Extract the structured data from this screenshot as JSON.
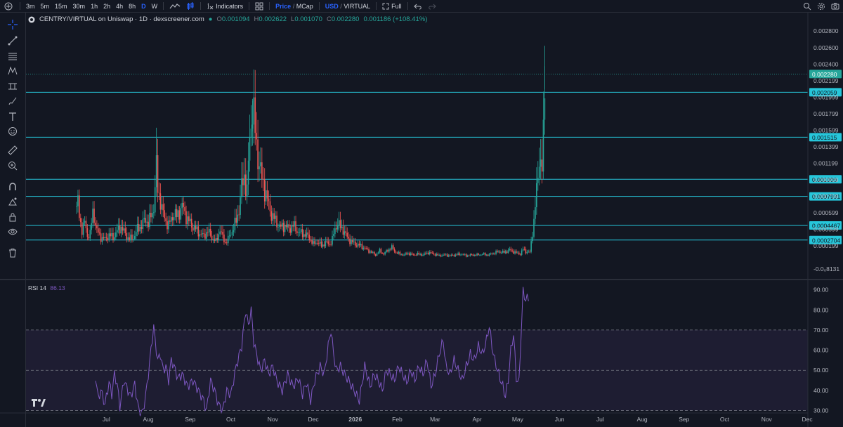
{
  "toolbar": {
    "timeframes": [
      "3m",
      "5m",
      "15m",
      "30m",
      "1h",
      "2h",
      "4h",
      "8h",
      "D",
      "W"
    ],
    "active_timeframe": "D",
    "indicators_label": "Indicators",
    "price_label": "Price",
    "mcap_label": "MCap",
    "price_mcap_sep": "/",
    "usd_label": "USD",
    "virtual_label": "VIRTUAL",
    "full_label": "Full"
  },
  "legend": {
    "title": "CENTRY/VIRTUAL on Uniswap · 1D · dexscreener.com",
    "open_label": "O",
    "open": "0.001094",
    "high_label": "H",
    "high": "0.002622",
    "low_label": "L",
    "low": "0.001070",
    "close_label": "C",
    "close": "0.002280",
    "change": "0.001186 (+108.41%)"
  },
  "rsi_legend": {
    "label": "RSI",
    "period": "14",
    "value": "86.13"
  },
  "colors": {
    "up": "#26a69a",
    "down": "#ef5350",
    "rsi_line": "#7e57c2",
    "rsi_band": "#7e57c2",
    "hline": "#26c6da",
    "background": "#131722",
    "accent": "#2962ff"
  },
  "chart_data": [
    {
      "type": "candlestick",
      "title": "CENTRY/VIRTUAL on Uniswap · 1D · dexscreener.com",
      "y_scale": "price",
      "ylim": [
        -8e-05,
        0.00287
      ],
      "y_ticks": [
        "0.002800",
        "0.002600",
        "0.002400",
        "0.002199",
        "0.001999",
        "0.001799",
        "0.001599",
        "0.001399",
        "0.001199",
        "0.000999",
        "0.000799",
        "0.000599",
        "0.000399",
        "0.000199"
      ],
      "y_tick_values": [
        0.0028,
        0.0026,
        0.0024,
        0.0022,
        0.002,
        0.0018,
        0.0016,
        0.0014,
        0.0012,
        0.001,
        0.0008,
        0.0006,
        0.0004,
        0.0002
      ],
      "bottom_tick": "-0.0⁠⁠​08131",
      "bottom_tick_value": -8.13e-05,
      "horizontal_lines": [
        0.002059,
        0.001515,
        0.001006,
        0.0007991,
        0.0004467,
        0.0002704
      ],
      "horizontal_line_labels": [
        "0.002059",
        "0.001515",
        "0.001006",
        "0.0007991",
        "0.0004467",
        "0.0002704"
      ],
      "last_price": 0.00228,
      "last_price_label": "0.002280",
      "x_tick_labels": [
        "Jul",
        "Aug",
        "Sep",
        "Oct",
        "Nov",
        "Dec",
        "2026",
        "Feb",
        "Mar",
        "Apr",
        "May",
        "Jun",
        "Jul",
        "Aug",
        "Sep",
        "Oct",
        "Nov",
        "Dec"
      ],
      "x_tick_days": [
        22,
        53,
        84,
        114,
        145,
        175,
        206,
        237,
        265,
        296,
        326,
        357,
        387,
        418,
        449,
        479,
        510,
        540
      ],
      "anchors_day_close": [
        [
          0,
          0.00068
        ],
        [
          1,
          0.00072
        ],
        [
          2,
          0.00055
        ],
        [
          4,
          0.0004
        ],
        [
          6,
          0.00048
        ],
        [
          8,
          0.00032
        ],
        [
          10,
          0.00035
        ],
        [
          12,
          0.0006
        ],
        [
          13,
          0.00055
        ],
        [
          15,
          0.00038
        ],
        [
          18,
          0.0003
        ],
        [
          21,
          0.00028
        ],
        [
          24,
          0.00033
        ],
        [
          27,
          0.0003
        ],
        [
          30,
          0.00038
        ],
        [
          33,
          0.00043
        ],
        [
          36,
          0.00034
        ],
        [
          39,
          0.00028
        ],
        [
          42,
          0.0003
        ],
        [
          45,
          0.0004
        ],
        [
          48,
          0.00045
        ],
        [
          51,
          0.00052
        ],
        [
          53,
          0.00048
        ],
        [
          55,
          0.00055
        ],
        [
          57,
          0.00066
        ],
        [
          58,
          0.00095
        ],
        [
          59,
          0.00112
        ],
        [
          60,
          0.00088
        ],
        [
          62,
          0.00075
        ],
        [
          64,
          0.00058
        ],
        [
          66,
          0.0005
        ],
        [
          68,
          0.00045
        ],
        [
          70,
          0.00052
        ],
        [
          72,
          0.0006
        ],
        [
          74,
          0.00055
        ],
        [
          76,
          0.00062
        ],
        [
          78,
          0.00068
        ],
        [
          80,
          0.0006
        ],
        [
          82,
          0.00052
        ],
        [
          85,
          0.00045
        ],
        [
          88,
          0.0004
        ],
        [
          91,
          0.00035
        ],
        [
          94,
          0.00032
        ],
        [
          97,
          0.00038
        ],
        [
          100,
          0.0003
        ],
        [
          103,
          0.00025
        ],
        [
          106,
          0.0004
        ],
        [
          108,
          0.0003
        ],
        [
          110,
          0.00024
        ],
        [
          112,
          0.00028
        ],
        [
          114,
          0.00035
        ],
        [
          116,
          0.00042
        ],
        [
          118,
          0.0005
        ],
        [
          120,
          0.00065
        ],
        [
          122,
          0.0009
        ],
        [
          124,
          0.00105
        ],
        [
          126,
          0.00085
        ],
        [
          128,
          0.0015
        ],
        [
          130,
          0.0019
        ],
        [
          131,
          0.00175
        ],
        [
          133,
          0.0014
        ],
        [
          135,
          0.0012
        ],
        [
          137,
          0.001
        ],
        [
          139,
          0.0009
        ],
        [
          141,
          0.00075
        ],
        [
          143,
          0.00063
        ],
        [
          145,
          0.00055
        ],
        [
          148,
          0.00048
        ],
        [
          151,
          0.00042
        ],
        [
          154,
          0.00045
        ],
        [
          157,
          0.0004
        ],
        [
          160,
          0.00045
        ],
        [
          163,
          0.00038
        ],
        [
          166,
          0.00035
        ],
        [
          169,
          0.00034
        ],
        [
          172,
          0.0003
        ],
        [
          175,
          0.00022
        ],
        [
          178,
          0.00025
        ],
        [
          181,
          0.0002
        ],
        [
          184,
          0.00024
        ],
        [
          187,
          0.00022
        ],
        [
          189,
          0.00028
        ],
        [
          191,
          0.0004
        ],
        [
          193,
          0.00048
        ],
        [
          195,
          0.00042
        ],
        [
          197,
          0.0004
        ],
        [
          200,
          0.0003
        ],
        [
          203,
          0.00025
        ],
        [
          206,
          0.00022
        ],
        [
          210,
          0.0002
        ],
        [
          214,
          0.00016
        ],
        [
          218,
          0.00012
        ],
        [
          221,
          9e-05
        ],
        [
          224,
          0.00014
        ],
        [
          227,
          0.0001
        ],
        [
          230,
          0.00015
        ],
        [
          233,
          0.00018
        ],
        [
          236,
          0.00012
        ],
        [
          239,
          0.0001
        ],
        [
          242,
          9e-05
        ],
        [
          245,
          0.00011
        ],
        [
          248,
          9e-05
        ],
        [
          252,
          0.0001
        ],
        [
          256,
          9e-05
        ],
        [
          260,
          0.00012
        ],
        [
          264,
          0.0001
        ],
        [
          268,
          8e-05
        ],
        [
          272,
          9e-05
        ],
        [
          276,
          8e-05
        ],
        [
          280,
          9e-05
        ],
        [
          284,
          0.0001
        ],
        [
          288,
          8e-05
        ],
        [
          292,
          9e-05
        ],
        [
          296,
          9e-05
        ],
        [
          300,
          0.0001
        ],
        [
          304,
          9e-05
        ],
        [
          308,
          0.00011
        ],
        [
          312,
          0.00013
        ],
        [
          316,
          0.00012
        ],
        [
          320,
          0.00015
        ],
        [
          324,
          0.00012
        ],
        [
          328,
          0.0001
        ],
        [
          330,
          0.00016
        ],
        [
          332,
          0.00013
        ],
        [
          335,
          0.00012
        ],
        [
          338,
          0.0005
        ],
        [
          340,
          0.00085
        ],
        [
          342,
          0.0013
        ],
        [
          344,
          0.0011
        ],
        [
          345,
          0.0015
        ],
        [
          346,
          0.00228
        ]
      ],
      "total_days": 346
    },
    {
      "type": "line",
      "title": "RSI 14",
      "ylim": [
        26,
        93
      ],
      "y_ticks": [
        "90.00",
        "80.00",
        "70.00",
        "60.00",
        "50.00",
        "40.00",
        "30.00"
      ],
      "y_tick_values": [
        90,
        80,
        70,
        60,
        50,
        40,
        30
      ],
      "bands": {
        "upper": 70,
        "middle": 50,
        "lower": 30
      },
      "last_value": 86.13,
      "anchors_day_value": [
        [
          14,
          47
        ],
        [
          16,
          36
        ],
        [
          18,
          40
        ],
        [
          21,
          33
        ],
        [
          24,
          44
        ],
        [
          26,
          38
        ],
        [
          28,
          48
        ],
        [
          30,
          43
        ],
        [
          32,
          32
        ],
        [
          35,
          45
        ],
        [
          38,
          40
        ],
        [
          40,
          37
        ],
        [
          43,
          43
        ],
        [
          46,
          30
        ],
        [
          49,
          29
        ],
        [
          52,
          42
        ],
        [
          55,
          60
        ],
        [
          57,
          72
        ],
        [
          58,
          65
        ],
        [
          60,
          55
        ],
        [
          62,
          58
        ],
        [
          64,
          50
        ],
        [
          66,
          52
        ],
        [
          68,
          45
        ],
        [
          70,
          55
        ],
        [
          72,
          52
        ],
        [
          75,
          46
        ],
        [
          78,
          48
        ],
        [
          82,
          42
        ],
        [
          86,
          45
        ],
        [
          90,
          40
        ],
        [
          94,
          35
        ],
        [
          96,
          30
        ],
        [
          99,
          45
        ],
        [
          102,
          40
        ],
        [
          105,
          33
        ],
        [
          108,
          30
        ],
        [
          111,
          40
        ],
        [
          114,
          38
        ],
        [
          118,
          52
        ],
        [
          122,
          62
        ],
        [
          125,
          80
        ],
        [
          127,
          72
        ],
        [
          129,
          80
        ],
        [
          131,
          64
        ],
        [
          133,
          58
        ],
        [
          136,
          50
        ],
        [
          139,
          55
        ],
        [
          142,
          48
        ],
        [
          145,
          52
        ],
        [
          148,
          45
        ],
        [
          152,
          40
        ],
        [
          156,
          48
        ],
        [
          160,
          42
        ],
        [
          164,
          46
        ],
        [
          167,
          38
        ],
        [
          170,
          44
        ],
        [
          173,
          35
        ],
        [
          176,
          45
        ],
        [
          180,
          52
        ],
        [
          183,
          48
        ],
        [
          186,
          62
        ],
        [
          188,
          70
        ],
        [
          190,
          58
        ],
        [
          192,
          50
        ],
        [
          195,
          52
        ],
        [
          198,
          48
        ],
        [
          201,
          45
        ],
        [
          205,
          40
        ],
        [
          209,
          35
        ],
        [
          213,
          52
        ],
        [
          217,
          42
        ],
        [
          220,
          48
        ],
        [
          223,
          45
        ],
        [
          226,
          40
        ],
        [
          229,
          50
        ],
        [
          232,
          48
        ],
        [
          235,
          45
        ],
        [
          238,
          52
        ],
        [
          241,
          48
        ],
        [
          244,
          44
        ],
        [
          247,
          50
        ],
        [
          250,
          45
        ],
        [
          253,
          52
        ],
        [
          256,
          48
        ],
        [
          259,
          55
        ],
        [
          262,
          42
        ],
        [
          265,
          48
        ],
        [
          268,
          58
        ],
        [
          271,
          65
        ],
        [
          273,
          52
        ],
        [
          276,
          48
        ],
        [
          279,
          55
        ],
        [
          282,
          50
        ],
        [
          285,
          45
        ],
        [
          288,
          52
        ],
        [
          291,
          58
        ],
        [
          294,
          55
        ],
        [
          297,
          62
        ],
        [
          300,
          58
        ],
        [
          303,
          65
        ],
        [
          305,
          72
        ],
        [
          307,
          62
        ],
        [
          309,
          55
        ],
        [
          312,
          48
        ],
        [
          315,
          42
        ],
        [
          317,
          37
        ],
        [
          319,
          45
        ],
        [
          321,
          60
        ],
        [
          323,
          68
        ],
        [
          325,
          46
        ],
        [
          327,
          44
        ],
        [
          329,
          75
        ],
        [
          330,
          89
        ],
        [
          332,
          85
        ],
        [
          334,
          86.13
        ]
      ]
    }
  ]
}
